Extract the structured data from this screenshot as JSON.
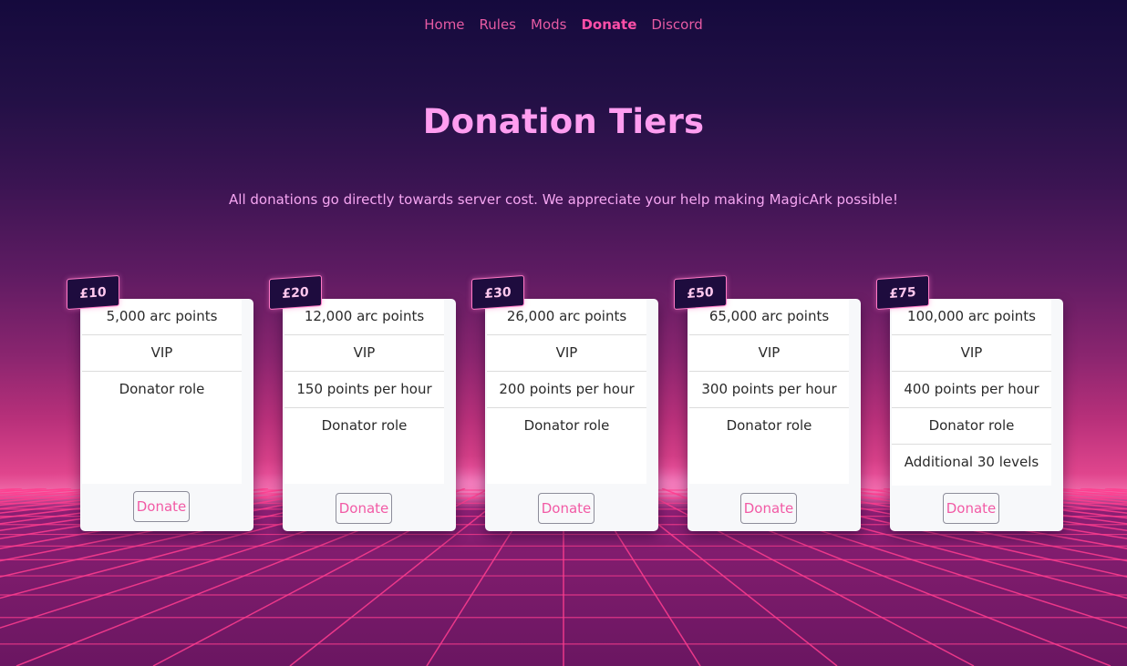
{
  "nav": {
    "items": [
      "Home",
      "Rules",
      "Mods",
      "Donate",
      "Discord"
    ],
    "active": "Donate"
  },
  "page": {
    "title": "Donation Tiers",
    "subtitle": "All donations go directly towards server cost. We appreciate your help making MagicArk possible!"
  },
  "tiers": [
    {
      "price": "£10",
      "perks": [
        "5,000 arc points",
        "VIP",
        "Donator role"
      ],
      "button": "Donate"
    },
    {
      "price": "£20",
      "perks": [
        "12,000 arc points",
        "VIP",
        "150 points per hour",
        "Donator role"
      ],
      "button": "Donate"
    },
    {
      "price": "£30",
      "perks": [
        "26,000 arc points",
        "VIP",
        "200 points per hour",
        "Donator role"
      ],
      "button": "Donate"
    },
    {
      "price": "£50",
      "perks": [
        "65,000 arc points",
        "VIP",
        "300 points per hour",
        "Donator role"
      ],
      "button": "Donate"
    },
    {
      "price": "£75",
      "perks": [
        "100,000 arc points",
        "VIP",
        "400 points per hour",
        "Donator role",
        "Additional 30 levels"
      ],
      "button": "Donate"
    }
  ],
  "colors": {
    "accent": "#ff4fa8",
    "title": "#ff9df0",
    "grid_line": "#ff3d8f",
    "badge_bg": "#1e0c3e"
  }
}
